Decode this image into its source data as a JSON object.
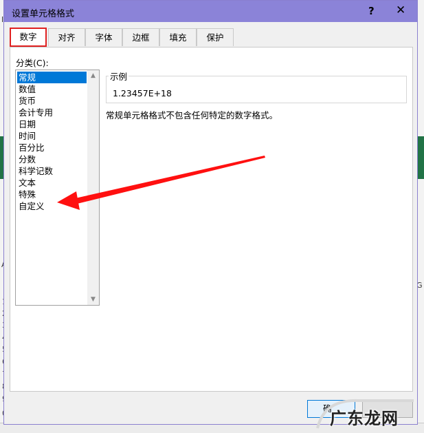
{
  "dialog": {
    "title": "设置单元格格式",
    "help_label": "?",
    "close_label": "✕"
  },
  "tabs": [
    {
      "label": "数字",
      "active": true
    },
    {
      "label": "对齐",
      "active": false
    },
    {
      "label": "字体",
      "active": false
    },
    {
      "label": "边框",
      "active": false
    },
    {
      "label": "填充",
      "active": false
    },
    {
      "label": "保护",
      "active": false
    }
  ],
  "category": {
    "label": "分类(C):",
    "items": [
      {
        "label": "常规",
        "selected": true
      },
      {
        "label": "数值",
        "selected": false
      },
      {
        "label": "货币",
        "selected": false
      },
      {
        "label": "会计专用",
        "selected": false
      },
      {
        "label": "日期",
        "selected": false
      },
      {
        "label": "时间",
        "selected": false
      },
      {
        "label": "百分比",
        "selected": false
      },
      {
        "label": "分数",
        "selected": false
      },
      {
        "label": "科学记数",
        "selected": false
      },
      {
        "label": "文本",
        "selected": false
      },
      {
        "label": "特殊",
        "selected": false
      },
      {
        "label": "自定义",
        "selected": false
      }
    ]
  },
  "sample": {
    "label": "示例",
    "value": "1.23457E+18"
  },
  "description": "常规单元格格式不包含任何特定的数字格式。",
  "buttons": {
    "ok_label": "确"
  },
  "watermark": {
    "text": "广东龙网"
  },
  "background": {
    "left_letters": [
      "Ⅱ",
      "A"
    ],
    "row_numbers": [
      "1",
      "2",
      "3",
      "4",
      "5",
      "6",
      "7",
      "8",
      "9",
      "0"
    ],
    "right_letter": "G"
  },
  "colors": {
    "titlebar": "#8b83d8",
    "selection": "#0078d7",
    "active_tab_border": "#e02020",
    "arrow": "#ff1010",
    "excel_green": "#217346"
  }
}
